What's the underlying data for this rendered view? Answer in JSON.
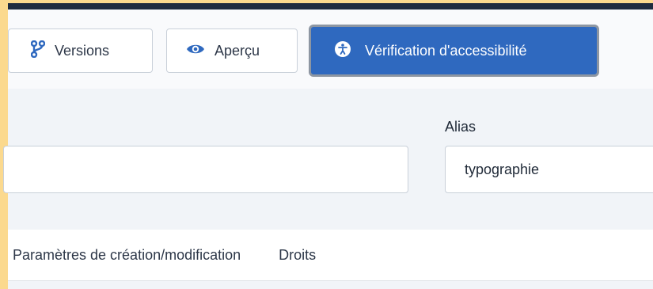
{
  "toolbar": {
    "versions_label": "Versions",
    "apercu_label": "Aperçu",
    "accessibility_label": "Vérification d'accessibilité"
  },
  "form": {
    "title_value": "",
    "alias_label": "Alias",
    "alias_value": "typographie"
  },
  "tabs": [
    {
      "label": "Paramètres de création/modification"
    },
    {
      "label": "Droits"
    }
  ],
  "colors": {
    "accent": "#2f69bf",
    "frame": "#fbd98e",
    "header": "#1e2b3f"
  },
  "icons": {
    "versions": "branch-icon",
    "apercu": "eye-icon",
    "accessibility": "accessibility-icon"
  }
}
